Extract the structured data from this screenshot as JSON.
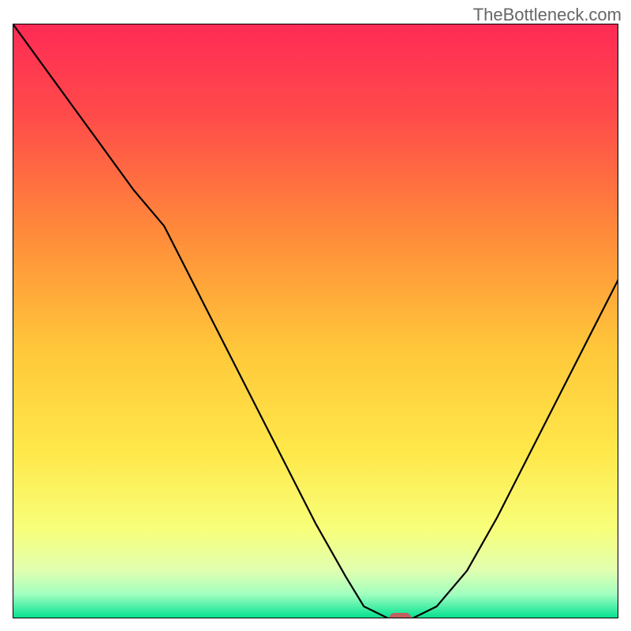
{
  "watermark": "TheBottleneck.com",
  "chart_data": {
    "type": "line",
    "title": "",
    "xlabel": "",
    "ylabel": "",
    "xlim": [
      0,
      100
    ],
    "ylim": [
      0,
      100
    ],
    "background_gradient": {
      "type": "vertical",
      "stops": [
        {
          "pos": 0.0,
          "color": "#FF2A55"
        },
        {
          "pos": 0.15,
          "color": "#FF4A4A"
        },
        {
          "pos": 0.35,
          "color": "#FF8A3A"
        },
        {
          "pos": 0.55,
          "color": "#FFC83A"
        },
        {
          "pos": 0.72,
          "color": "#FFE84A"
        },
        {
          "pos": 0.85,
          "color": "#F8FF7A"
        },
        {
          "pos": 0.92,
          "color": "#E0FFB0"
        },
        {
          "pos": 0.96,
          "color": "#A0FFC0"
        },
        {
          "pos": 1.0,
          "color": "#00E090"
        }
      ]
    },
    "series": [
      {
        "name": "bottleneck-curve",
        "color": "#000000",
        "x": [
          0,
          5,
          10,
          15,
          20,
          25,
          30,
          35,
          40,
          45,
          50,
          55,
          58,
          62,
          66,
          70,
          75,
          80,
          85,
          90,
          95,
          100
        ],
        "y": [
          100,
          93,
          86,
          79,
          72,
          66,
          56,
          46,
          36,
          26,
          16,
          7,
          2,
          0,
          0,
          2,
          8,
          17,
          27,
          37,
          47,
          57
        ]
      }
    ],
    "marker": {
      "name": "optimal-point",
      "x": 64,
      "y": 0,
      "color": "#C06060",
      "shape": "rounded-rect"
    }
  }
}
